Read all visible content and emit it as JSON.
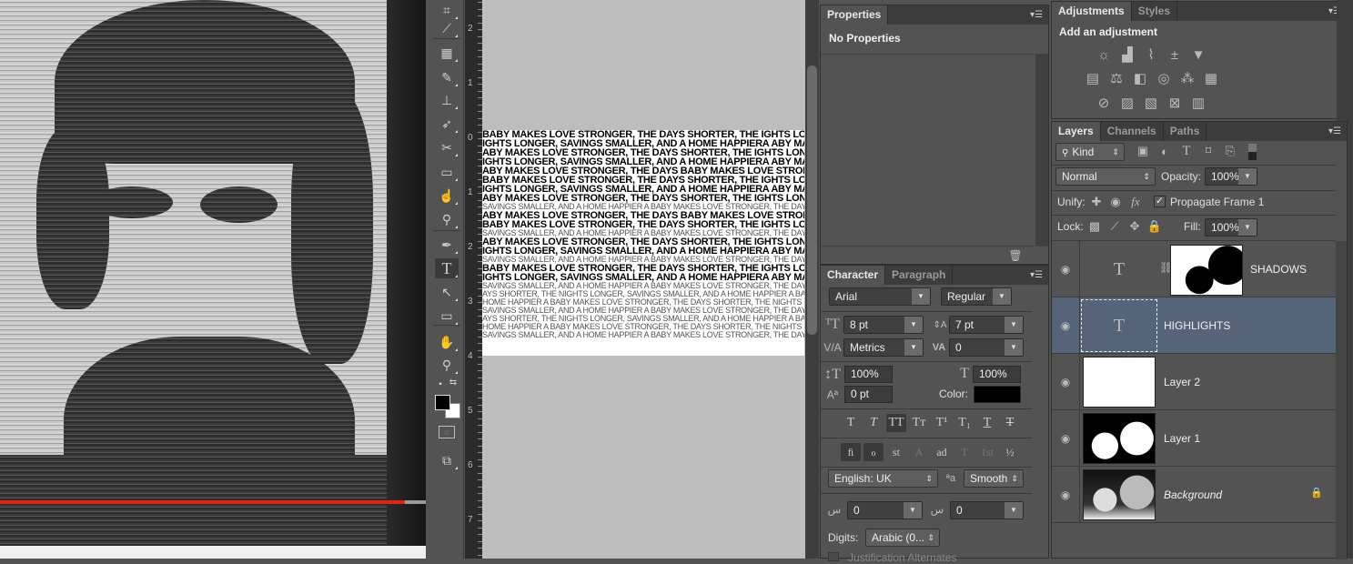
{
  "video": {
    "progress_fraction": 0.95
  },
  "toolbar": {
    "tools": [
      {
        "name": "crop-tool",
        "glyph": "⌗"
      },
      {
        "name": "eyedropper-tool",
        "glyph": "⟋"
      },
      {
        "name": "spot-healing-tool",
        "glyph": "▦"
      },
      {
        "name": "brush-tool",
        "glyph": "✎"
      },
      {
        "name": "clone-stamp-tool",
        "glyph": "⊥"
      },
      {
        "name": "history-brush-tool",
        "glyph": "➶"
      },
      {
        "name": "eraser-tool",
        "glyph": "✂"
      },
      {
        "name": "gradient-tool",
        "glyph": "▭"
      },
      {
        "name": "blur-tool",
        "glyph": "☝"
      },
      {
        "name": "dodge-tool",
        "glyph": "⚲"
      },
      {
        "name": "pen-tool",
        "glyph": "✒"
      },
      {
        "name": "type-tool",
        "glyph": "T"
      },
      {
        "name": "path-selection-tool",
        "glyph": "↖"
      },
      {
        "name": "rectangle-tool",
        "glyph": "▭"
      },
      {
        "name": "hand-tool",
        "glyph": "✋"
      },
      {
        "name": "zoom-tool",
        "glyph": "⚲"
      }
    ]
  },
  "ruler": {
    "labels": [
      "2",
      "1",
      "0",
      "1",
      "2",
      "3",
      "4",
      "5",
      "6",
      "7"
    ]
  },
  "document": {
    "lines_bold": [
      "BABY MAKES LOVE STRONGER, THE DAYS SHORTER, THE",
      "IGHTS LONGER, SAVINGS SMALLER, AND A HOME HAPPIERA",
      "ABY MAKES LOVE STRONGER, THE DAYS SHORTER, THE",
      "IGHTS LONGER, SAVINGS SMALLER, AND A HOME HAPPIERA",
      "ABY MAKES LOVE STRONGER, THE DAYS"
    ],
    "lines_light": [
      "AYS SHORTER, THE NIGHTS LONGER, SAVINGS SMALLER, AND A HOME HAPPIER A BABY MAKES LOVE STRONGER",
      "HOME HAPPIER A BABY MAKES LOVE STRONGER, THE DAYS SHORTER, THE NIGHTS LONGER, SAVINGS SMALLER",
      "SAVINGS SMALLER, AND A HOME HAPPIER A BABY MAKES LOVE STRONGER, THE DAYS SHORTER, THE NIGHTS"
    ]
  },
  "properties": {
    "tab": "Properties",
    "message": "No Properties"
  },
  "character": {
    "tabs": [
      "Character",
      "Paragraph"
    ],
    "font_family": "Arial",
    "font_style": "Regular",
    "font_size": "8 pt",
    "leading": "7 pt",
    "kerning": "Metrics",
    "tracking": "0",
    "vertical_scale": "100%",
    "horizontal_scale": "100%",
    "baseline_shift": "0 pt",
    "color_label": "Color:",
    "color": "#000000",
    "type_styles": [
      "T",
      "T",
      "TT",
      "Tт",
      "T¹",
      "T₁",
      "T",
      "T"
    ],
    "opentype": [
      "ﬁ",
      "ℴ",
      "st",
      "A",
      "ad",
      "T",
      "1st",
      "½"
    ],
    "language": "English: UK",
    "antialias": "Smooth",
    "arabic_a": "0",
    "arabic_b": "0",
    "digits_label": "Digits:",
    "digits": "Arabic (0...",
    "justification_alternates": "Justification Alternates"
  },
  "adjustments": {
    "tabs": [
      "Adjustments",
      "Styles"
    ],
    "heading": "Add an adjustment",
    "row1": [
      "brightness-contrast",
      "levels",
      "curves",
      "exposure",
      "vibrance"
    ],
    "row2": [
      "hue-saturation",
      "color-balance",
      "black-white",
      "photo-filter",
      "channel-mixer",
      "color-lookup"
    ],
    "row3": [
      "invert",
      "posterize",
      "threshold",
      "selective-color",
      "gradient-map"
    ]
  },
  "layers": {
    "tabs": [
      "Layers",
      "Channels",
      "Paths"
    ],
    "filter": "Kind",
    "blend_mode": "Normal",
    "opacity_label": "Opacity:",
    "opacity": "100%",
    "unify_label": "Unify:",
    "propagate_label": "Propagate Frame 1",
    "propagate_checked": true,
    "lock_label": "Lock:",
    "fill_label": "Fill:",
    "fill": "100%",
    "items": [
      {
        "name": "SHADOWS",
        "type": "text-with-mask",
        "selected": false
      },
      {
        "name": "HIGHLIGHTS",
        "type": "text",
        "selected": true
      },
      {
        "name": "Layer 2",
        "type": "white",
        "selected": false
      },
      {
        "name": "Layer 1",
        "type": "mask",
        "selected": false
      },
      {
        "name": "Background",
        "type": "photo",
        "selected": false,
        "locked": true
      }
    ]
  }
}
